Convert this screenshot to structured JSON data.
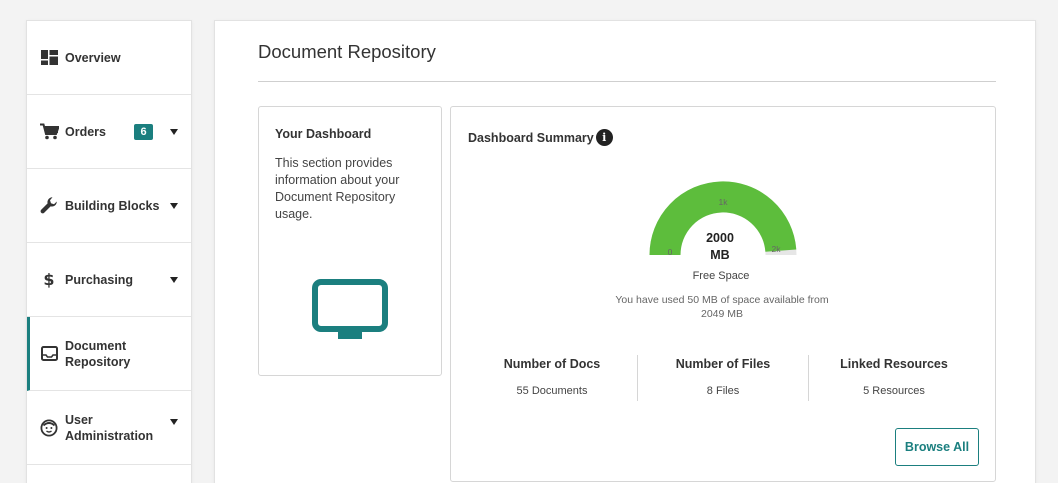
{
  "sidebar": {
    "items": [
      {
        "label": "Overview",
        "icon": "dashboard-grid-icon"
      },
      {
        "label": "Orders",
        "icon": "cart-icon",
        "badge": "6"
      },
      {
        "label": "Building Blocks",
        "icon": "wrench-icon"
      },
      {
        "label": "Purchasing",
        "icon": "dollar-icon"
      },
      {
        "label": "Document Repository",
        "icon": "inbox-tray-icon",
        "active": true
      },
      {
        "label": "User Administration",
        "icon": "user-face-icon"
      }
    ]
  },
  "main": {
    "title": "Document Repository",
    "intro_card": {
      "heading": "Your Dashboard",
      "body": "This section provides information about your Document Repository usage.",
      "icon": "monitor-icon"
    },
    "summary": {
      "heading": "Dashboard Summary",
      "info_icon": "info-icon",
      "gauge": {
        "min_label": "0",
        "mid_label": "1k",
        "max_label": "2k",
        "value_line1": "2000",
        "value_line2": "MB",
        "caption": "Free Space",
        "fill_fraction": 0.976,
        "fill_color": "#5dbd3c",
        "track_color": "#e6e6e6"
      },
      "usage_text": "You have used 50 MB of space available from 2049 MB",
      "stats": [
        {
          "label": "Number of Docs",
          "value": "55 Documents"
        },
        {
          "label": "Number of Files",
          "value": "8 Files"
        },
        {
          "label": "Linked Resources",
          "value": "5 Resources"
        }
      ],
      "browse_button": "Browse All"
    }
  },
  "colors": {
    "accent": "#1b7f7f",
    "gauge_green": "#5dbd3c"
  }
}
